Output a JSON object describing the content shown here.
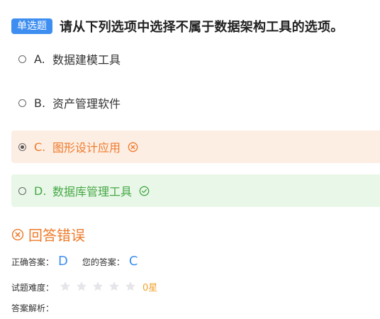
{
  "question": {
    "type_badge": "单选题",
    "text": "请从下列选项中选择不属于数据架构工具的选项。"
  },
  "options": [
    {
      "letter": "A.",
      "label": "数据建模工具",
      "selected": false,
      "state": "normal"
    },
    {
      "letter": "B.",
      "label": "资产管理软件",
      "selected": false,
      "state": "normal"
    },
    {
      "letter": "C.",
      "label": "图形设计应用",
      "selected": true,
      "state": "wrong",
      "icon": "circle-x-icon"
    },
    {
      "letter": "D.",
      "label": "数据库管理工具",
      "selected": false,
      "state": "correct",
      "icon": "circle-check-icon"
    }
  ],
  "result": {
    "icon": "circle-x-icon",
    "text": "回答错误"
  },
  "answer": {
    "correct_label": "正确答案：",
    "correct_value": "D",
    "yours_label": "您的答案：",
    "yours_value": "C"
  },
  "difficulty": {
    "label": "试题难度：",
    "stars_total": 5,
    "stars_filled": 0,
    "count_text": "0星"
  },
  "analysis": {
    "label": "答案解析："
  },
  "colors": {
    "accent_blue": "#3d8ef0",
    "wrong_orange": "#ee7a2a",
    "wrong_bg": "#fdeee4",
    "correct_green": "#46a846",
    "correct_bg": "#e9f7e8",
    "star_empty": "#e6e6ea",
    "star_text": "#f0a12a"
  }
}
